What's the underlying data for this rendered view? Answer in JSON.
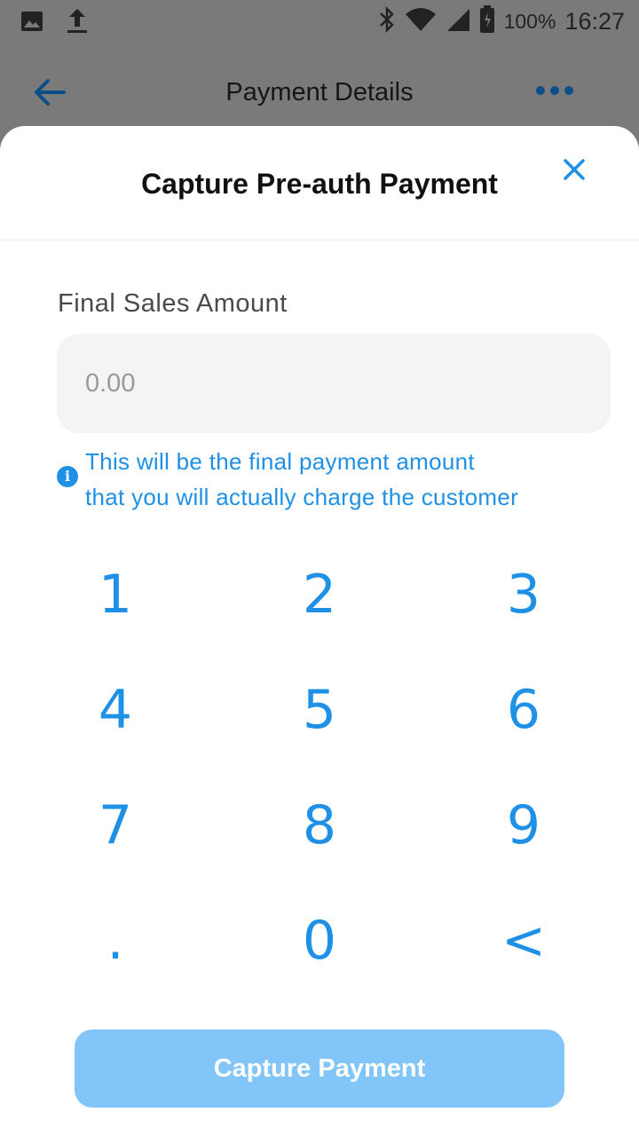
{
  "status_bar": {
    "battery": "100%",
    "time": "16:27"
  },
  "header": {
    "title": "Payment Details"
  },
  "sheet": {
    "title": "Capture Pre-auth Payment",
    "field_label": "Final Sales Amount",
    "amount_placeholder": "0.00",
    "info_line1": "This will be the final payment amount",
    "info_line2": "that you will actually charge the customer",
    "info_icon_glyph": "i",
    "capture_label": "Capture Payment"
  },
  "keypad": {
    "keys": [
      "1",
      "2",
      "3",
      "4",
      "5",
      "6",
      "7",
      "8",
      "9",
      ".",
      "0",
      "<"
    ]
  },
  "colors": {
    "accent": "#1e90e6",
    "button_disabled": "#82c6f9",
    "overlay": "#7a7a7a",
    "header_icon": "#0b4f86"
  },
  "icons": {
    "status_left": [
      "image-icon",
      "upload-icon"
    ],
    "status_right": [
      "bluetooth-icon",
      "wifi-icon",
      "signal-icon",
      "battery-icon"
    ],
    "header": [
      "back-arrow-icon",
      "more-dots-icon"
    ],
    "sheet": [
      "close-icon",
      "info-icon"
    ]
  }
}
